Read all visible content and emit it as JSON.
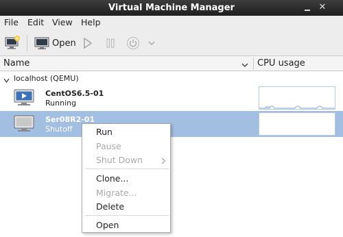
{
  "window": {
    "title": "Virtual Machine Manager",
    "minimize_glyph": "",
    "close_glyph": "✕"
  },
  "menubar": {
    "items": [
      "File",
      "Edit",
      "View",
      "Help"
    ]
  },
  "toolbar": {
    "new_icon": "new-vm-icon",
    "open_label": "Open",
    "run_icon": "play-icon",
    "pause_icon": "pause-icon",
    "power_icon": "power-icon",
    "dropdown_icon": "chevron-down-icon"
  },
  "columns": {
    "name": "Name",
    "cpu": "CPU usage"
  },
  "connection": {
    "label": "localhost (QEMU)"
  },
  "vms": [
    {
      "name": "CentOS6.5-01",
      "status": "Running",
      "selected": false
    },
    {
      "name": "Ser08R2-01",
      "status": "Shutoff",
      "selected": true
    }
  ],
  "context_menu": {
    "run": "Run",
    "pause": "Pause",
    "shutdown": "Shut Down",
    "clone": "Clone...",
    "migrate": "Migrate...",
    "delete": "Delete",
    "open": "Open"
  },
  "colors": {
    "titlebar": "#2b2b2b",
    "selection": "#a2bfe2",
    "cpu_line": "#aac2e3",
    "vm_running_screen": "#3b73b8"
  }
}
